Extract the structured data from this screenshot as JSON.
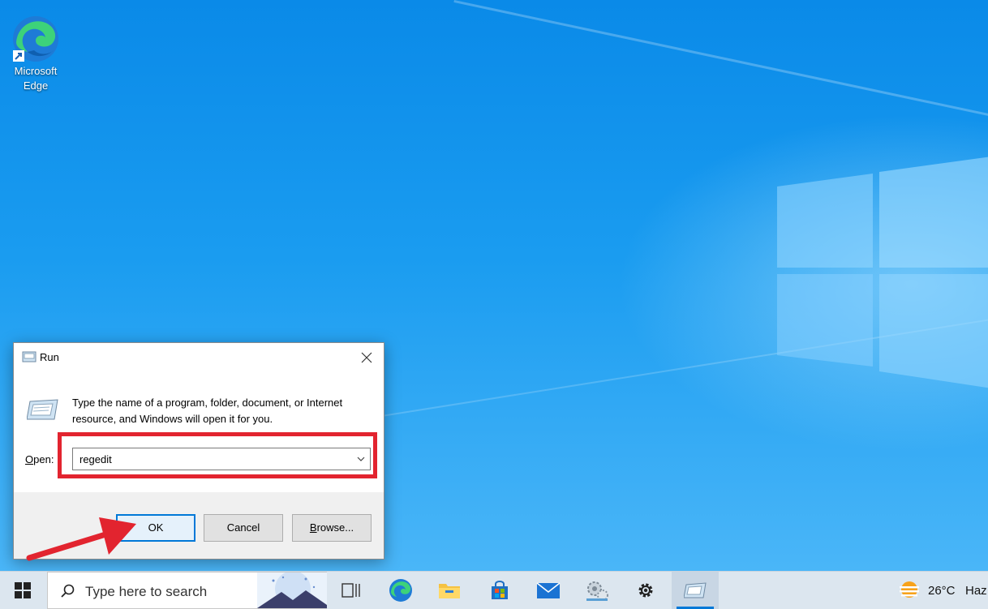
{
  "desktop": {
    "icons": [
      {
        "label_line1": "Microsoft",
        "label_line2": "Edge",
        "icon": "edge-icon"
      }
    ]
  },
  "run_dialog": {
    "title": "Run",
    "description": "Type the name of a program, folder, document, or Internet resource, and Windows will open it for you.",
    "open_label_access": "O",
    "open_label_rest": "pen:",
    "input_value": "regedit",
    "buttons": {
      "ok": "OK",
      "cancel": "Cancel",
      "browse_access": "B",
      "browse_rest": "rowse..."
    },
    "highlight_color": "#e2242f"
  },
  "taskbar": {
    "search_placeholder": "Type here to search",
    "pinned": [
      "task-view-icon",
      "edge-icon",
      "file-explorer-icon",
      "store-icon",
      "mail-icon",
      "control-panel-icon",
      "settings-icon",
      "run-icon"
    ],
    "weather_temp": "26°C",
    "weather_condition": "Haz"
  },
  "colors": {
    "accent": "#0078d7",
    "annotation_red": "#e2242f"
  }
}
